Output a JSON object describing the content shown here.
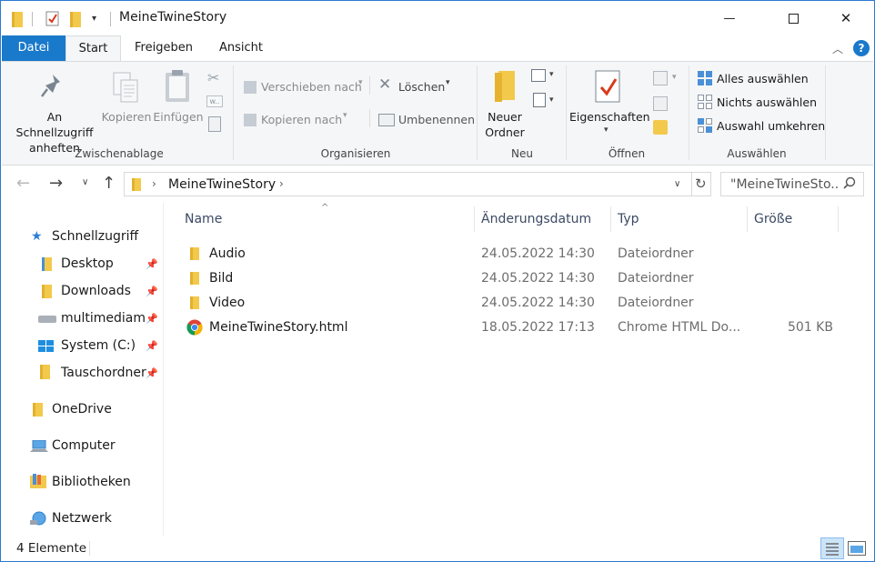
{
  "window": {
    "title": "MeineTwineStory",
    "minimize_glyph": "—",
    "maximize_glyph": "☐",
    "close_glyph": "✕"
  },
  "tabs": [
    "Datei",
    "Start",
    "Freigeben",
    "Ansicht"
  ],
  "ribbon": {
    "clipboard": {
      "pin_label_1": "An Schnellzugriff",
      "pin_label_2": "anheften",
      "copy_label": "Kopieren",
      "paste_label": "Einfügen",
      "group": "Zwischenablage"
    },
    "organize": {
      "move_to": "Verschieben nach",
      "copy_to": "Kopieren nach",
      "delete": "Löschen",
      "rename": "Umbenennen",
      "group": "Organisieren"
    },
    "new": {
      "new_folder_1": "Neuer",
      "new_folder_2": "Ordner",
      "group": "Neu"
    },
    "open": {
      "properties": "Eigenschaften",
      "group": "Öffnen"
    },
    "select": {
      "select_all": "Alles auswählen",
      "select_none": "Nichts auswählen",
      "invert": "Auswahl umkehren",
      "group": "Auswählen"
    }
  },
  "address": {
    "path": "MeineTwineStory",
    "search_placeholder": "\"MeineTwineSto..."
  },
  "nav_pane": {
    "quick_access": "Schnellzugriff",
    "items": [
      "Desktop",
      "Downloads",
      "multimediam",
      "System (C:)",
      "Tauschordner"
    ],
    "onedrive": "OneDrive",
    "computer": "Computer",
    "libraries": "Bibliotheken",
    "network": "Netzwerk"
  },
  "columns": {
    "name": "Name",
    "date": "Änderungsdatum",
    "type": "Typ",
    "size": "Größe"
  },
  "files": [
    {
      "name": "Audio",
      "date": "24.05.2022 14:30",
      "type": "Dateiordner",
      "size": "",
      "icon": "folder-icon"
    },
    {
      "name": "Bild",
      "date": "24.05.2022 14:30",
      "type": "Dateiordner",
      "size": "",
      "icon": "folder-icon"
    },
    {
      "name": "Video",
      "date": "24.05.2022 14:30",
      "type": "Dateiordner",
      "size": "",
      "icon": "folder-icon"
    },
    {
      "name": "MeineTwineStory.html",
      "date": "18.05.2022 17:13",
      "type": "Chrome HTML Do...",
      "size": "501 KB",
      "icon": "chrome-icon"
    }
  ],
  "status": {
    "count": "4 Elemente"
  },
  "colors": {
    "accent": "#1979ca",
    "folder": "#f3c94c"
  }
}
